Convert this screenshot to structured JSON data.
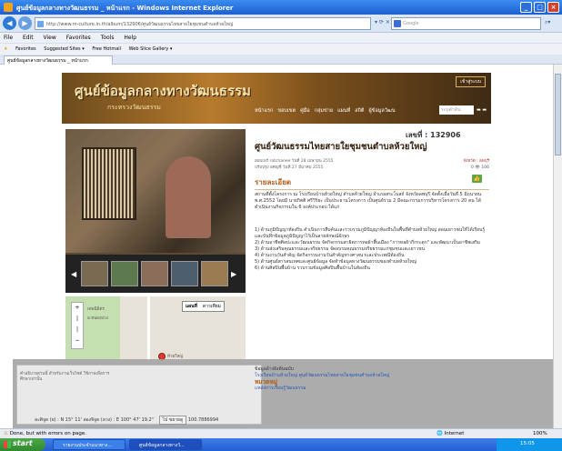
{
  "window": {
    "title": "ศูนย์ข้อมูลกลางทางวัฒนธรรม _ หน้าแรก - Windows Internet Explorer",
    "controls": [
      "_",
      "□",
      "×"
    ]
  },
  "address": {
    "url": "http://www.m-culture.in.th/album/132906/ศูนย์วัฒนธรรมไทยสายใยชุมชนตำบลห้วยใหญ่",
    "search_placeholder": "Google"
  },
  "menu": [
    "File",
    "Edit",
    "View",
    "Favorites",
    "Tools",
    "Help"
  ],
  "favorites": {
    "label": "Favorites",
    "items": [
      "Suggested Sites ▾",
      "Free Hotmail",
      "Web Slice Gallery ▾"
    ]
  },
  "tab": {
    "label": "ศูนย์ข้อมูลกลางทางวัฒนธรรม _ หน้าแรก"
  },
  "site": {
    "logo": "ศูนย์ข้อมูลกลางทางวัฒนธรรม",
    "subtitle": "กระทรวงวัฒนธรรม",
    "lang_button": "เข้าสู่ระบบ",
    "nav": [
      "หน้าแรก",
      "ขอบเขต",
      "คู่มือ",
      "กลุ่มข่าย",
      "แผนที่",
      "สถิติ",
      "ผู้ข้อมูลวัฒน"
    ],
    "search_placeholder": "ระบุคำค้น"
  },
  "record": {
    "number": "เลขที่ : 132906",
    "title": "ศูนย์วัฒนธรรมไทยสายใยชุมชนตำบลห้วยใหญ่",
    "meta_line1": "เผยแพร่ ratchanee วันที่ 28 เมษายน 2555",
    "meta_line2": "ปรับปรุง อศญชี วันที่ 27 มีนาคม 2555",
    "meta_right1": "จังหวัด : ลพบุรี",
    "meta_right2": "0 👁 106",
    "detail_heading": "รายละเอียด",
    "intro": "สถานที่ตั้งโครงการ ณ โรงเรียนบ้านห้วยใหญ่ ตำบลห้วยใหญ่ อำเภอสระโบสถ์ จังหวัดลพบุรี จัดตั้งเมื่อวันที่ 5 มิถุนายน พ.ศ.2552 โดยมี นายกิตติ ศรีวิริยะ เป็นประธานโครงการ เป็นศูนย์รวม 2 มีคณะกรรมการบริหารโครงการ 20 คน ได้ดำเนินงานกิจกรรมใน 6 องค์ประกอบ ได้แก่",
    "body": "1) ด้านภูมิปัญญาท้องถิ่น ดำเนินการสืบค้นและรวบรวมภูมิปัญญาท้องถิ่นในพื้นที่ตำบลห้วยใหญ่ สอนเยาวชนให้ได้เรียนรู้ และบันทึกข้อมูลภูมิปัญญาไว้เป็นลายลักษณ์อักษร\n2) ด้านอาชีพศิลปะและวัฒนธรรม จัดกิจกรรมสาธิตการทอผ้าพื้นเมือง \"การทอผ้ากี่กระตุก\" และพัฒนาเป็นอาชีพเสริม\n3) ด้านส่งเสริมคุณธรรมและจริยธรรม จัดอบรมคุณธรรมจริยธรรมแก่ชุมชนและเยาวชน\n4) ด้านงานวันสำคัญ จัดกิจกรรมงานวันสำคัญทางศาสนาและประเพณีท้องถิ่น\n5) ด้านศูนย์สารสนเทศและศูนย์ข้อมูล จัดทำข้อมูลทางวัฒนธรรมของตำบลห้วยใหญ่\n6) ด้านศิลปินพื้นบ้าน รวบรวมข้อมูลศิลปินพื้นบ้านในท้องถิ่น"
  },
  "map": {
    "map_button": "แผนที่",
    "sat_button": "ดาวเทียม",
    "labels": [
      "เทพนิมิตร",
      "อ.หนองม่วง",
      "จังหวัดลพบุรี",
      "ห้วยใหญ่",
      "บ้านบ่อ"
    ]
  },
  "overlay": {
    "note": "คำอธิบายส่วนนี้ สำหรับงานเว็บไซต์ ใช้ภาพเพื่อการศึกษาเท่านั้น",
    "source_label": "ข้อมูลอ้างอิงต้นฉบับ",
    "link": "โรงเรียนบ้านห้วยใหญ่ ศูนย์วัฒนธรรมไทยสายใยชุมชนตำบลห้วยใหญ่",
    "section": "หมวดหมู่",
    "section_item": "แหล่งการเรียนรู้วัฒนธรรม",
    "coords_prefix": "ละติจูด (ย) :",
    "lat": "N 15° 11'",
    "lon_label": "ลองจิจูด (ลวง) : E 100° 47' 19.2\"",
    "zoom_value": "100.7886994",
    "view_btn": "ไป ขยายดู"
  },
  "status": {
    "text": "Done, but with errors on page.",
    "zone": "Internet",
    "zoom": "100%"
  },
  "taskbar": {
    "start": "start",
    "tasks": [
      "รายงานประจำแนวทาง...",
      "ศูนย์ข้อมูลกลางทางวั..."
    ],
    "clock": "15:05"
  }
}
